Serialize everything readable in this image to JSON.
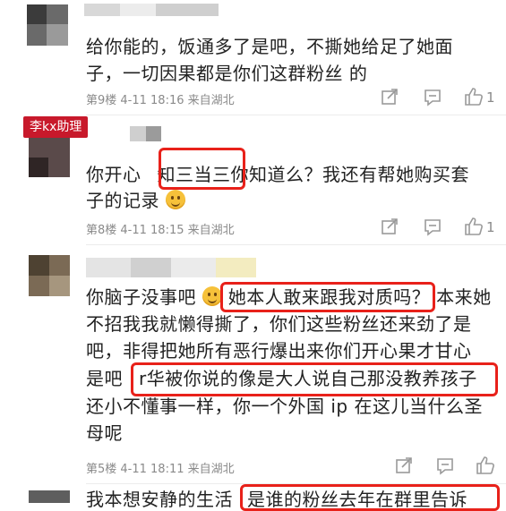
{
  "comments": [
    {
      "lines": [
        "给你能的，饭通多了是吧，不撕她给足了她面",
        "子，一切因果都是你们这群粉丝  的"
      ],
      "meta": "第9楼  4-11  18:16  来自湖北",
      "like_count": "1"
    },
    {
      "badge": "李kx助理",
      "line1_a": "你开心",
      "line1_b": "知三当三",
      "line1_c": "你知道么？我还有帮她购买套",
      "line2": "子的记录",
      "meta": "第8楼  4-11  18:15  来自湖北",
      "like_count": "1"
    },
    {
      "line1_a": "你脑子没事吧",
      "line1_b": "她本人敢来跟我对质吗？",
      "line1_c": "本来她",
      "lines_mid": [
        "不招我我就懒得撕了，你们这些粉丝还来劲了是",
        "吧，非得把她所有恶行爆出来你们开心果才甘心"
      ],
      "line4_a": "是吧",
      "line4_b": "r华被你说的像是大人说自己那没教养孩子",
      "lines_end": [
        "还小不懂事一样，你一个外国 ip 在这儿当什么圣",
        "母呢"
      ],
      "meta": "第5楼  4-11  18:11  来自湖北"
    },
    {
      "line1_a": "我本想安静的生活",
      "line1_b": "是谁的粉丝去年在群里告诉"
    }
  ]
}
